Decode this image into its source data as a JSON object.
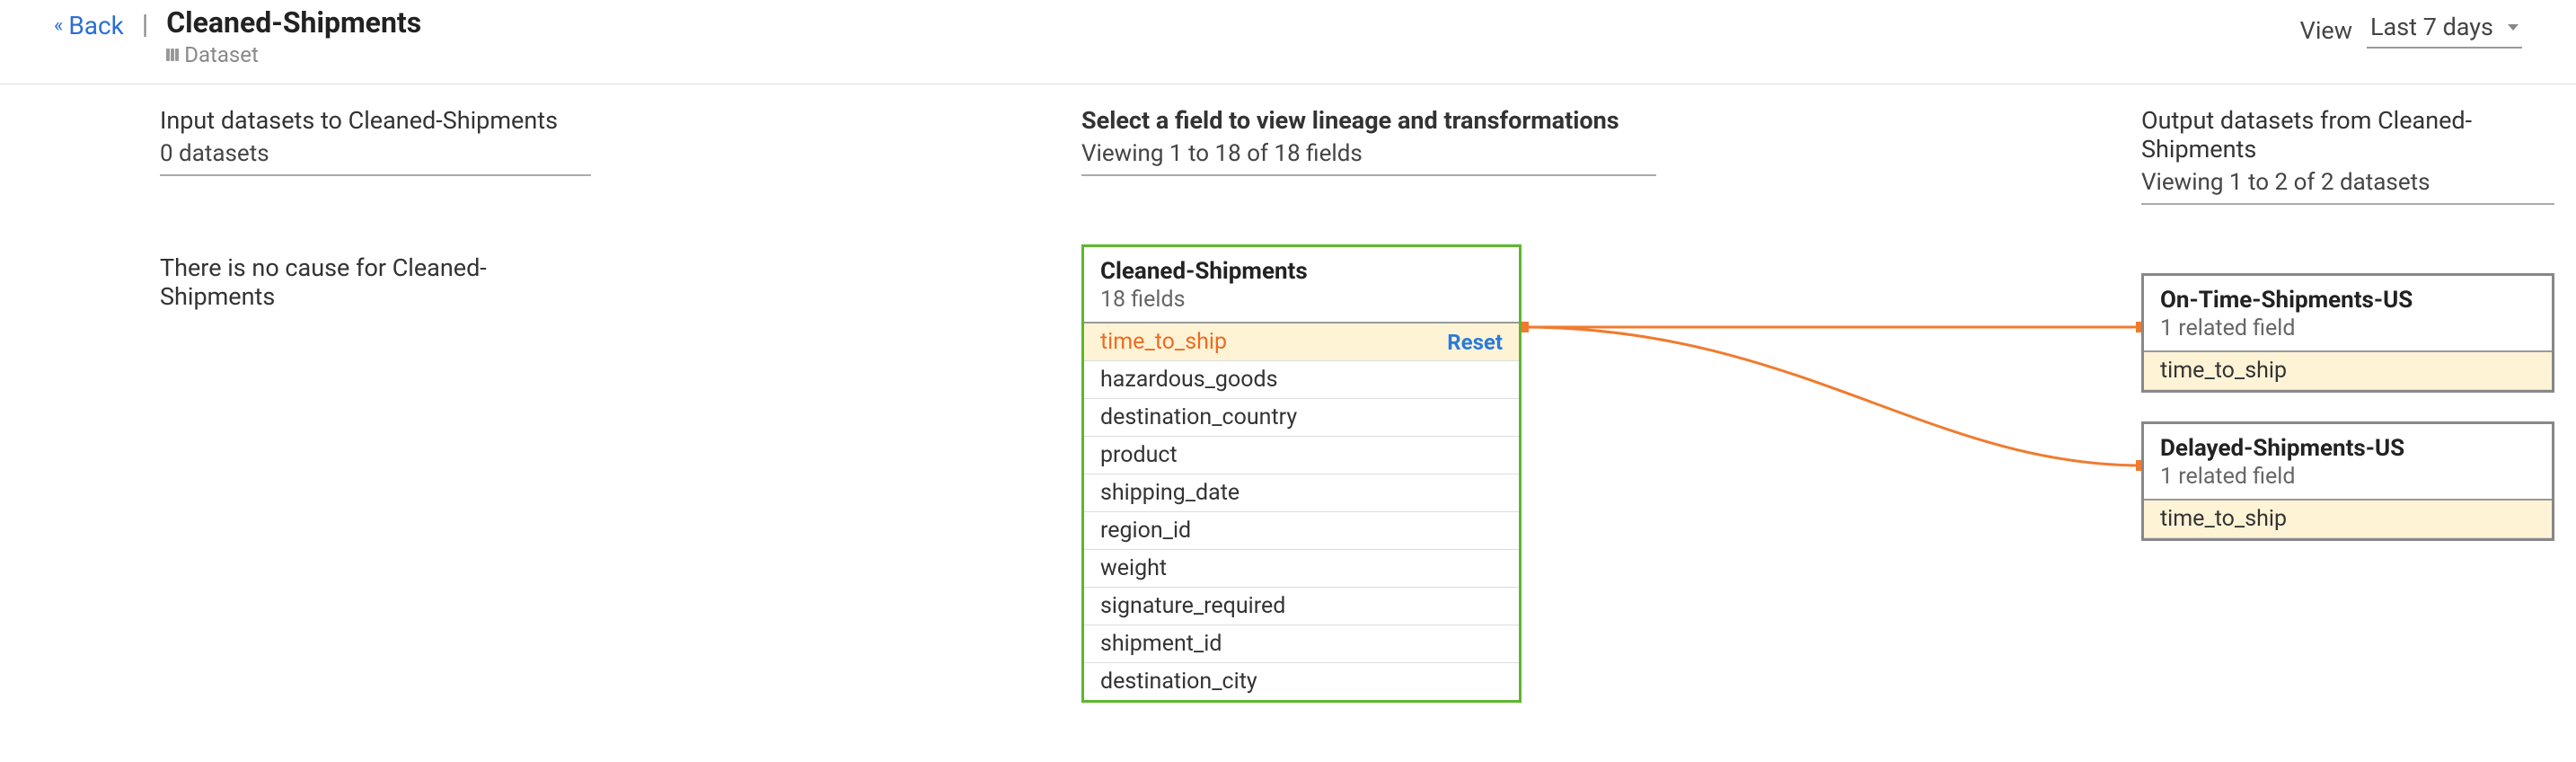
{
  "header": {
    "back_label": "Back",
    "title": "Cleaned-Shipments",
    "subtitle": "Dataset",
    "view_label": "View",
    "view_value": "Last 7 days"
  },
  "input_col": {
    "heading": "Input datasets to Cleaned-Shipments",
    "sub": "0 datasets",
    "empty_msg": "There is no cause for Cleaned-Shipments"
  },
  "center_col": {
    "heading": "Select a field to view lineage and transformations",
    "sub": "Viewing 1 to 18 of 18 fields",
    "card_title": "Cleaned-Shipments",
    "card_sub": "18 fields",
    "reset_label": "Reset",
    "selected_field": "time_to_ship",
    "fields": [
      "time_to_ship",
      "hazardous_goods",
      "destination_country",
      "product",
      "shipping_date",
      "region_id",
      "weight",
      "signature_required",
      "shipment_id",
      "destination_city"
    ]
  },
  "output_col": {
    "heading": "Output datasets from Cleaned-Shipments",
    "sub": "Viewing 1 to 2 of 2 datasets",
    "cards": [
      {
        "title": "On-Time-Shipments-US",
        "sub": "1 related field",
        "field": "time_to_ship"
      },
      {
        "title": "Delayed-Shipments-US",
        "sub": "1 related field",
        "field": "time_to_ship"
      }
    ]
  }
}
